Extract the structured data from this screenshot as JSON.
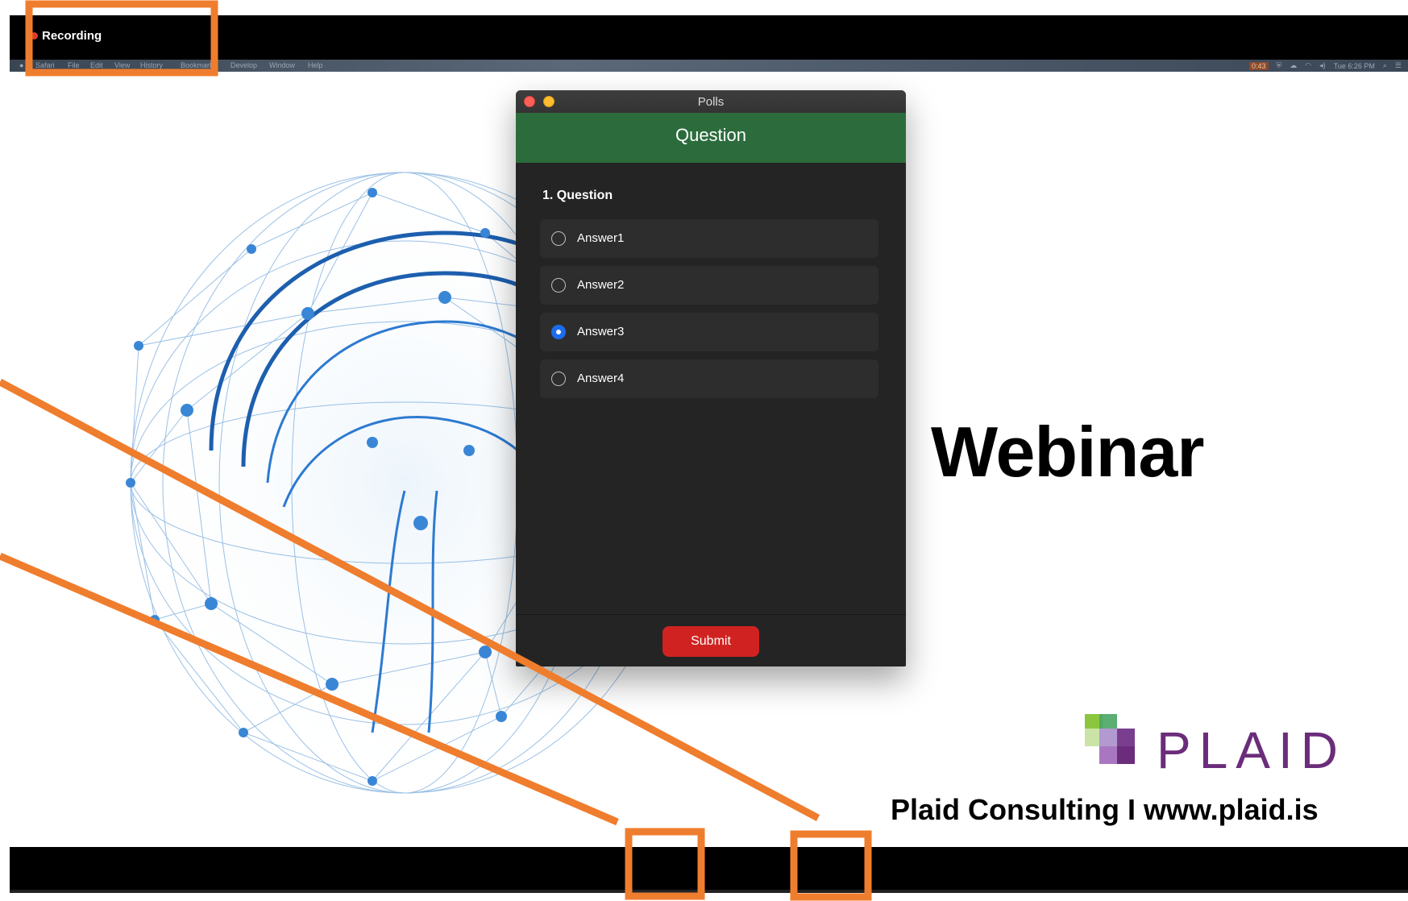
{
  "recording": {
    "label": "Recording"
  },
  "menubar": {
    "items": [
      "Safari",
      "File",
      "Edit",
      "View",
      "History",
      "Bookmarks",
      "Develop",
      "Window",
      "Help"
    ],
    "clock": "Tue 6:26 PM",
    "battery": "0:43"
  },
  "polls": {
    "window_title": "Polls",
    "header": "Question",
    "question": "1. Question",
    "answers": [
      {
        "label": "Answer1",
        "selected": false
      },
      {
        "label": "Answer2",
        "selected": false
      },
      {
        "label": "Answer3",
        "selected": true
      },
      {
        "label": "Answer4",
        "selected": false
      }
    ],
    "submit_label": "Submit"
  },
  "slide": {
    "title": "Webinar",
    "logo_word": "PLAID",
    "footer": "Plaid Consulting I www.plaid.is"
  },
  "colors": {
    "header_green": "#2c6c3c",
    "submit_red": "#d02321",
    "radio_blue": "#1d6cf0",
    "annotation_orange": "#ef7d2e",
    "plaid_purple": "#6b2d7b"
  }
}
